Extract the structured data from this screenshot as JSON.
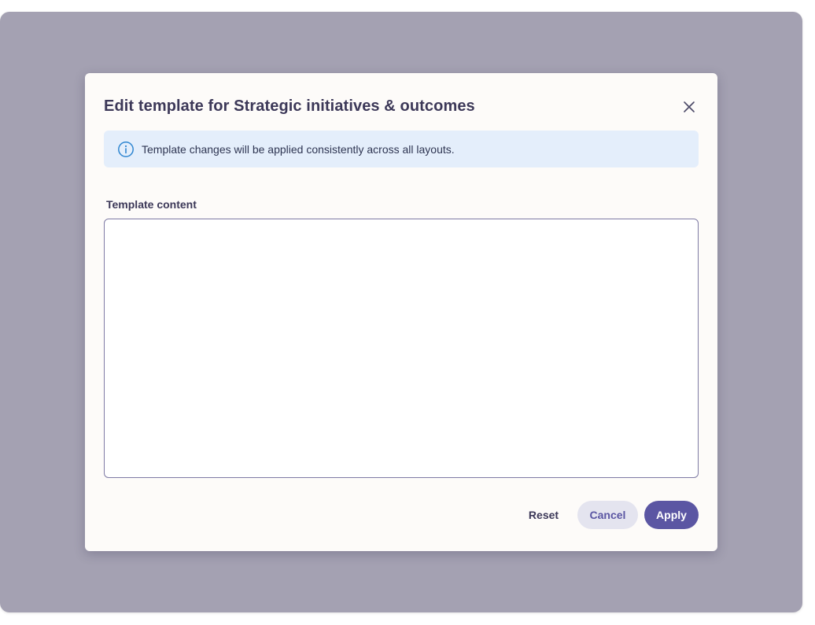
{
  "dialog": {
    "title": "Edit template for Strategic initiatives & outcomes",
    "close_icon": "close-icon"
  },
  "info_banner": {
    "icon": "info-icon",
    "text": "Template changes will be applied consistently across all layouts.",
    "background": "#e4eefb",
    "icon_color": "#2f86d1"
  },
  "template_field": {
    "label": "Template content",
    "value": "",
    "placeholder": ""
  },
  "actions": {
    "reset_label": "Reset",
    "cancel_label": "Cancel",
    "apply_label": "Apply"
  },
  "colors": {
    "accent": "#5b56a3",
    "backdrop": "#a4a1b2",
    "title": "#3c3858"
  }
}
